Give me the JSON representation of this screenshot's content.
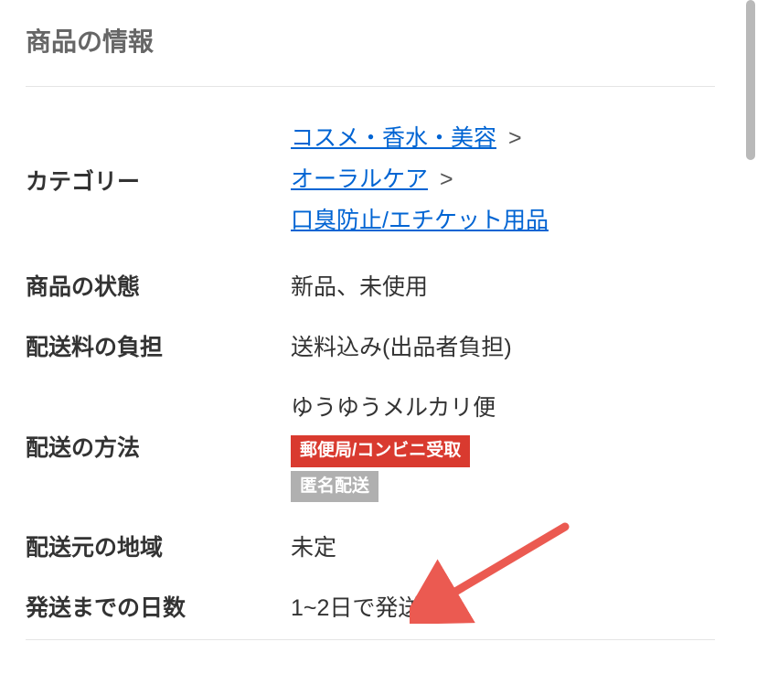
{
  "section_title": "商品の情報",
  "rows": {
    "category": {
      "label": "カテゴリー",
      "crumbs": [
        "コスメ・香水・美容",
        "オーラルケア",
        "口臭防止/エチケット用品"
      ],
      "separator": ">"
    },
    "condition": {
      "label": "商品の状態",
      "value": "新品、未使用"
    },
    "shipping_fee": {
      "label": "配送料の負担",
      "value": "送料込み(出品者負担)"
    },
    "shipping_method": {
      "label": "配送の方法",
      "name": "ゆうゆうメルカリ便",
      "badges": [
        {
          "text": "郵便局/コンビニ受取",
          "style": "red"
        },
        {
          "text": "匿名配送",
          "style": "gray"
        }
      ]
    },
    "ship_from": {
      "label": "配送元の地域",
      "value": "未定"
    },
    "ship_days": {
      "label": "発送までの日数",
      "value": "1~2日で発送"
    }
  }
}
